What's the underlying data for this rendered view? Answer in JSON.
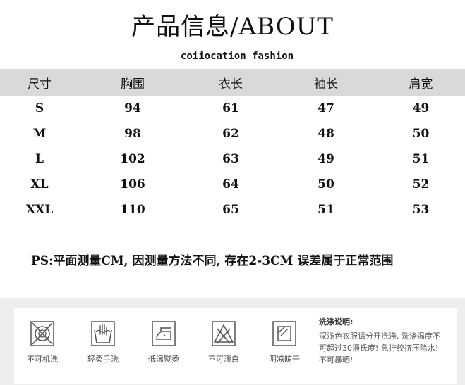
{
  "title": "产品信息/ABOUT",
  "subtitle": "coiiocation fashion",
  "table": {
    "headers": [
      "尺寸",
      "胸围",
      "衣长",
      "袖长",
      "肩宽"
    ],
    "rows": [
      [
        "S",
        "94",
        "61",
        "47",
        "49"
      ],
      [
        "M",
        "98",
        "62",
        "48",
        "50"
      ],
      [
        "L",
        "102",
        "63",
        "49",
        "51"
      ],
      [
        "XL",
        "106",
        "64",
        "50",
        "52"
      ],
      [
        "XXL",
        "110",
        "65",
        "51",
        "53"
      ]
    ]
  },
  "note": "PS:平面测量CM, 因测量方法不同, 存在2-3CM 误差属于正常范围",
  "care": {
    "icons": [
      {
        "icon": "no-machine-wash-icon",
        "label": "不可机洗"
      },
      {
        "icon": "gentle-hand-wash-icon",
        "label": "轻柔手洗"
      },
      {
        "icon": "low-temperature-iron-icon",
        "label": "低温熨烫"
      },
      {
        "icon": "do-not-bleach-icon",
        "label": "不可漂白"
      },
      {
        "icon": "line-dry-in-shade-icon",
        "label": "阴凉晾干"
      }
    ],
    "title": "洗涤说明:",
    "text": "深浅色衣服请分开洗涤, 洗涤温度不可超过30摄氏度! 急拧绞挤压除水! 不可暴晒!"
  }
}
